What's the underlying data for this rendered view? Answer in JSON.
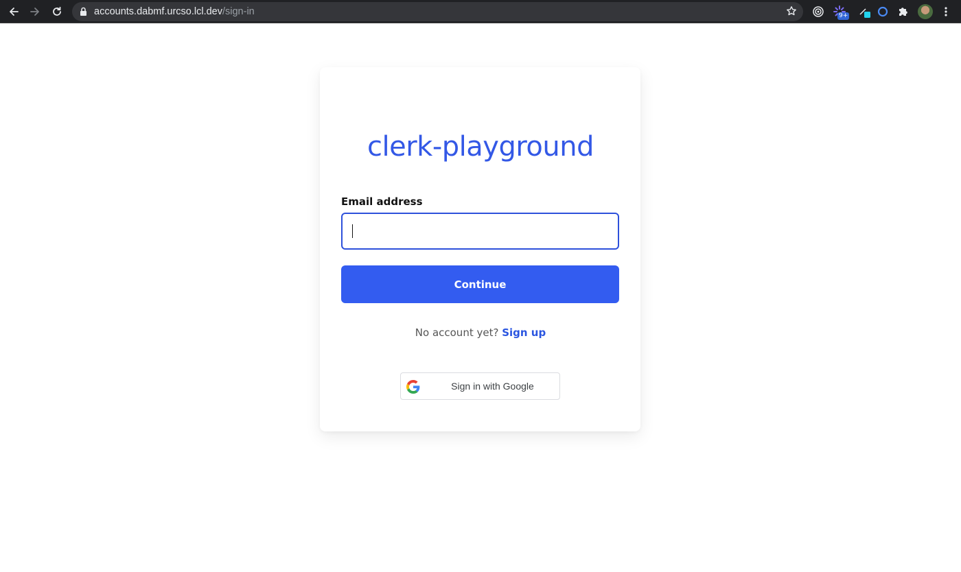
{
  "browser": {
    "url_host": "accounts.dabmf.urcso.lcl.dev",
    "url_path": "/sign-in",
    "extension_badge": "9+",
    "icons": [
      "back-icon",
      "forward-icon",
      "reload-icon",
      "lock-icon",
      "star-icon",
      "extension-icon",
      "puzzle-icon",
      "avatar",
      "menu-icon"
    ]
  },
  "signin": {
    "brand": "clerk-playground",
    "email_label": "Email address",
    "email_value": "",
    "continue_label": "Continue",
    "no_account_text": "No account yet?",
    "signup_link": "Sign up",
    "google_label": "Sign in with Google"
  },
  "colors": {
    "accent": "#335cf0",
    "brand_text": "#3358e6",
    "input_border": "#2d50db",
    "link": "#2a55e0"
  }
}
